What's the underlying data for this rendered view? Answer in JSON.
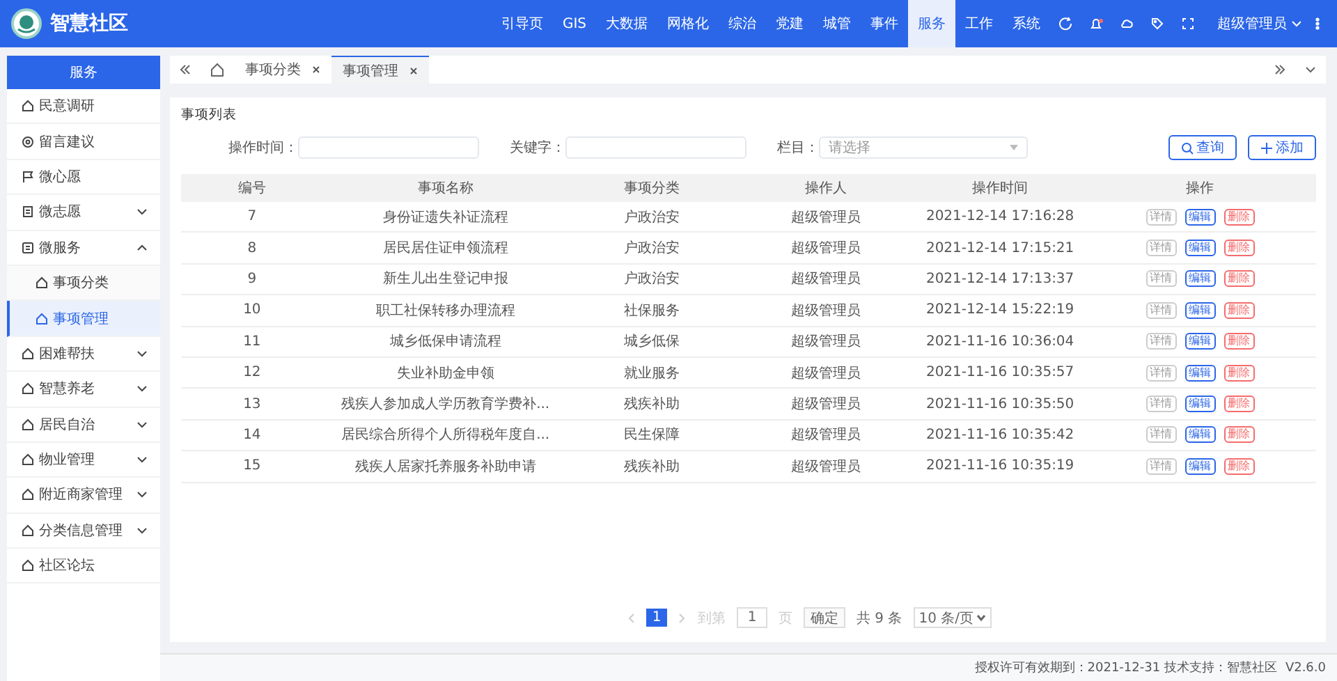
{
  "app": {
    "title": "智慧社区"
  },
  "nav": [
    {
      "label": "引导页",
      "selected": false
    },
    {
      "label": "GIS",
      "selected": false
    },
    {
      "label": "大数据",
      "selected": false
    },
    {
      "label": "网格化",
      "selected": false
    },
    {
      "label": "综治",
      "selected": false
    },
    {
      "label": "党建",
      "selected": false
    },
    {
      "label": "城管",
      "selected": false
    },
    {
      "label": "事件",
      "selected": false
    },
    {
      "label": "服务",
      "selected": true
    },
    {
      "label": "工作",
      "selected": false
    },
    {
      "label": "系统",
      "selected": false
    }
  ],
  "user": {
    "name": "超级管理员"
  },
  "sidebar": {
    "title": "服务",
    "items": [
      {
        "label": "民意调研",
        "kind": "link",
        "selected": false
      },
      {
        "label": "留言建议",
        "kind": "link",
        "selected": false
      },
      {
        "label": "微心愿",
        "kind": "link",
        "selected": false
      },
      {
        "label": "微志愿",
        "kind": "group",
        "expanded": false
      },
      {
        "label": "微服务",
        "kind": "group",
        "expanded": true,
        "children": [
          {
            "label": "事项分类",
            "selected": false
          },
          {
            "label": "事项管理",
            "selected": true
          }
        ]
      },
      {
        "label": "困难帮扶",
        "kind": "group",
        "expanded": false
      },
      {
        "label": "智慧养老",
        "kind": "group",
        "expanded": false
      },
      {
        "label": "居民自治",
        "kind": "group",
        "expanded": false
      },
      {
        "label": "物业管理",
        "kind": "group",
        "expanded": false
      },
      {
        "label": "附近商家管理",
        "kind": "group",
        "expanded": false
      },
      {
        "label": "分类信息管理",
        "kind": "group",
        "expanded": false
      },
      {
        "label": "社区论坛",
        "kind": "link",
        "selected": false
      }
    ]
  },
  "tabs": [
    {
      "label": "事项分类",
      "selected": false
    },
    {
      "label": "事项管理",
      "selected": true
    }
  ],
  "panel": {
    "title": "事项列表",
    "filters": [
      {
        "label": "操作时间：",
        "kind": "input"
      },
      {
        "label": "关键字：",
        "kind": "input"
      },
      {
        "label": "栏目：",
        "kind": "select",
        "placeholder": "请选择"
      }
    ],
    "buttons": [
      {
        "label": "查询",
        "kind": "search"
      },
      {
        "label": "添加",
        "kind": "add"
      }
    ],
    "table": {
      "columns": [
        "编号",
        "事项名称",
        "事项分类",
        "操作人",
        "操作时间",
        "操作"
      ],
      "rows": [
        {
          "cells": [
            "7",
            "身份证遗失补证流程",
            "户政治安",
            "超级管理员",
            "2021-12-14 17:16:28"
          ],
          "actions": [
            {
              "label": "详情",
              "kind": "view"
            },
            {
              "label": "编辑",
              "kind": "edit"
            },
            {
              "label": "删除",
              "kind": "delete"
            }
          ]
        },
        {
          "cells": [
            "8",
            "居民居住证申领流程",
            "户政治安",
            "超级管理员",
            "2021-12-14 17:15:21"
          ],
          "actions": [
            {
              "label": "详情",
              "kind": "view"
            },
            {
              "label": "编辑",
              "kind": "edit"
            },
            {
              "label": "删除",
              "kind": "delete"
            }
          ]
        },
        {
          "cells": [
            "9",
            "新生儿出生登记申报",
            "户政治安",
            "超级管理员",
            "2021-12-14 17:13:37"
          ],
          "actions": [
            {
              "label": "详情",
              "kind": "view"
            },
            {
              "label": "编辑",
              "kind": "edit"
            },
            {
              "label": "删除",
              "kind": "delete"
            }
          ]
        },
        {
          "cells": [
            "10",
            "职工社保转移办理流程",
            "社保服务",
            "超级管理员",
            "2021-12-14 15:22:19"
          ],
          "actions": [
            {
              "label": "详情",
              "kind": "view"
            },
            {
              "label": "编辑",
              "kind": "edit"
            },
            {
              "label": "删除",
              "kind": "delete"
            }
          ]
        },
        {
          "cells": [
            "11",
            "城乡低保申请流程",
            "城乡低保",
            "超级管理员",
            "2021-11-16 10:36:04"
          ],
          "actions": [
            {
              "label": "详情",
              "kind": "view"
            },
            {
              "label": "编辑",
              "kind": "edit"
            },
            {
              "label": "删除",
              "kind": "delete"
            }
          ]
        },
        {
          "cells": [
            "12",
            "失业补助金申领",
            "就业服务",
            "超级管理员",
            "2021-11-16 10:35:57"
          ],
          "actions": [
            {
              "label": "详情",
              "kind": "view"
            },
            {
              "label": "编辑",
              "kind": "edit"
            },
            {
              "label": "删除",
              "kind": "delete"
            }
          ]
        },
        {
          "cells": [
            "13",
            "残疾人参加成人学历教育学费补...",
            "残疾补助",
            "超级管理员",
            "2021-11-16 10:35:50"
          ],
          "actions": [
            {
              "label": "详情",
              "kind": "view"
            },
            {
              "label": "编辑",
              "kind": "edit"
            },
            {
              "label": "删除",
              "kind": "delete"
            }
          ]
        },
        {
          "cells": [
            "14",
            "居民综合所得个人所得税年度自...",
            "民生保障",
            "超级管理员",
            "2021-11-16 10:35:42"
          ],
          "actions": [
            {
              "label": "详情",
              "kind": "view"
            },
            {
              "label": "编辑",
              "kind": "edit"
            },
            {
              "label": "删除",
              "kind": "delete"
            }
          ]
        },
        {
          "cells": [
            "15",
            "残疾人居家托养服务补助申请",
            "残疾补助",
            "超级管理员",
            "2021-11-16 10:35:19"
          ],
          "actions": [
            {
              "label": "详情",
              "kind": "view"
            },
            {
              "label": "编辑",
              "kind": "edit"
            },
            {
              "label": "删除",
              "kind": "delete"
            }
          ]
        }
      ]
    },
    "pagination": {
      "pages": [
        {
          "label": "1",
          "selected": true
        }
      ],
      "goto_label": "到第",
      "goto_value": "1",
      "page_unit": "页",
      "confirm": "确定",
      "total": "共 9 条",
      "page_size": "10 条/页"
    }
  },
  "footer": {
    "license": "授权许可有效期到：2021-12-31 技术支持：智慧社区",
    "version": "V2.6.0"
  }
}
